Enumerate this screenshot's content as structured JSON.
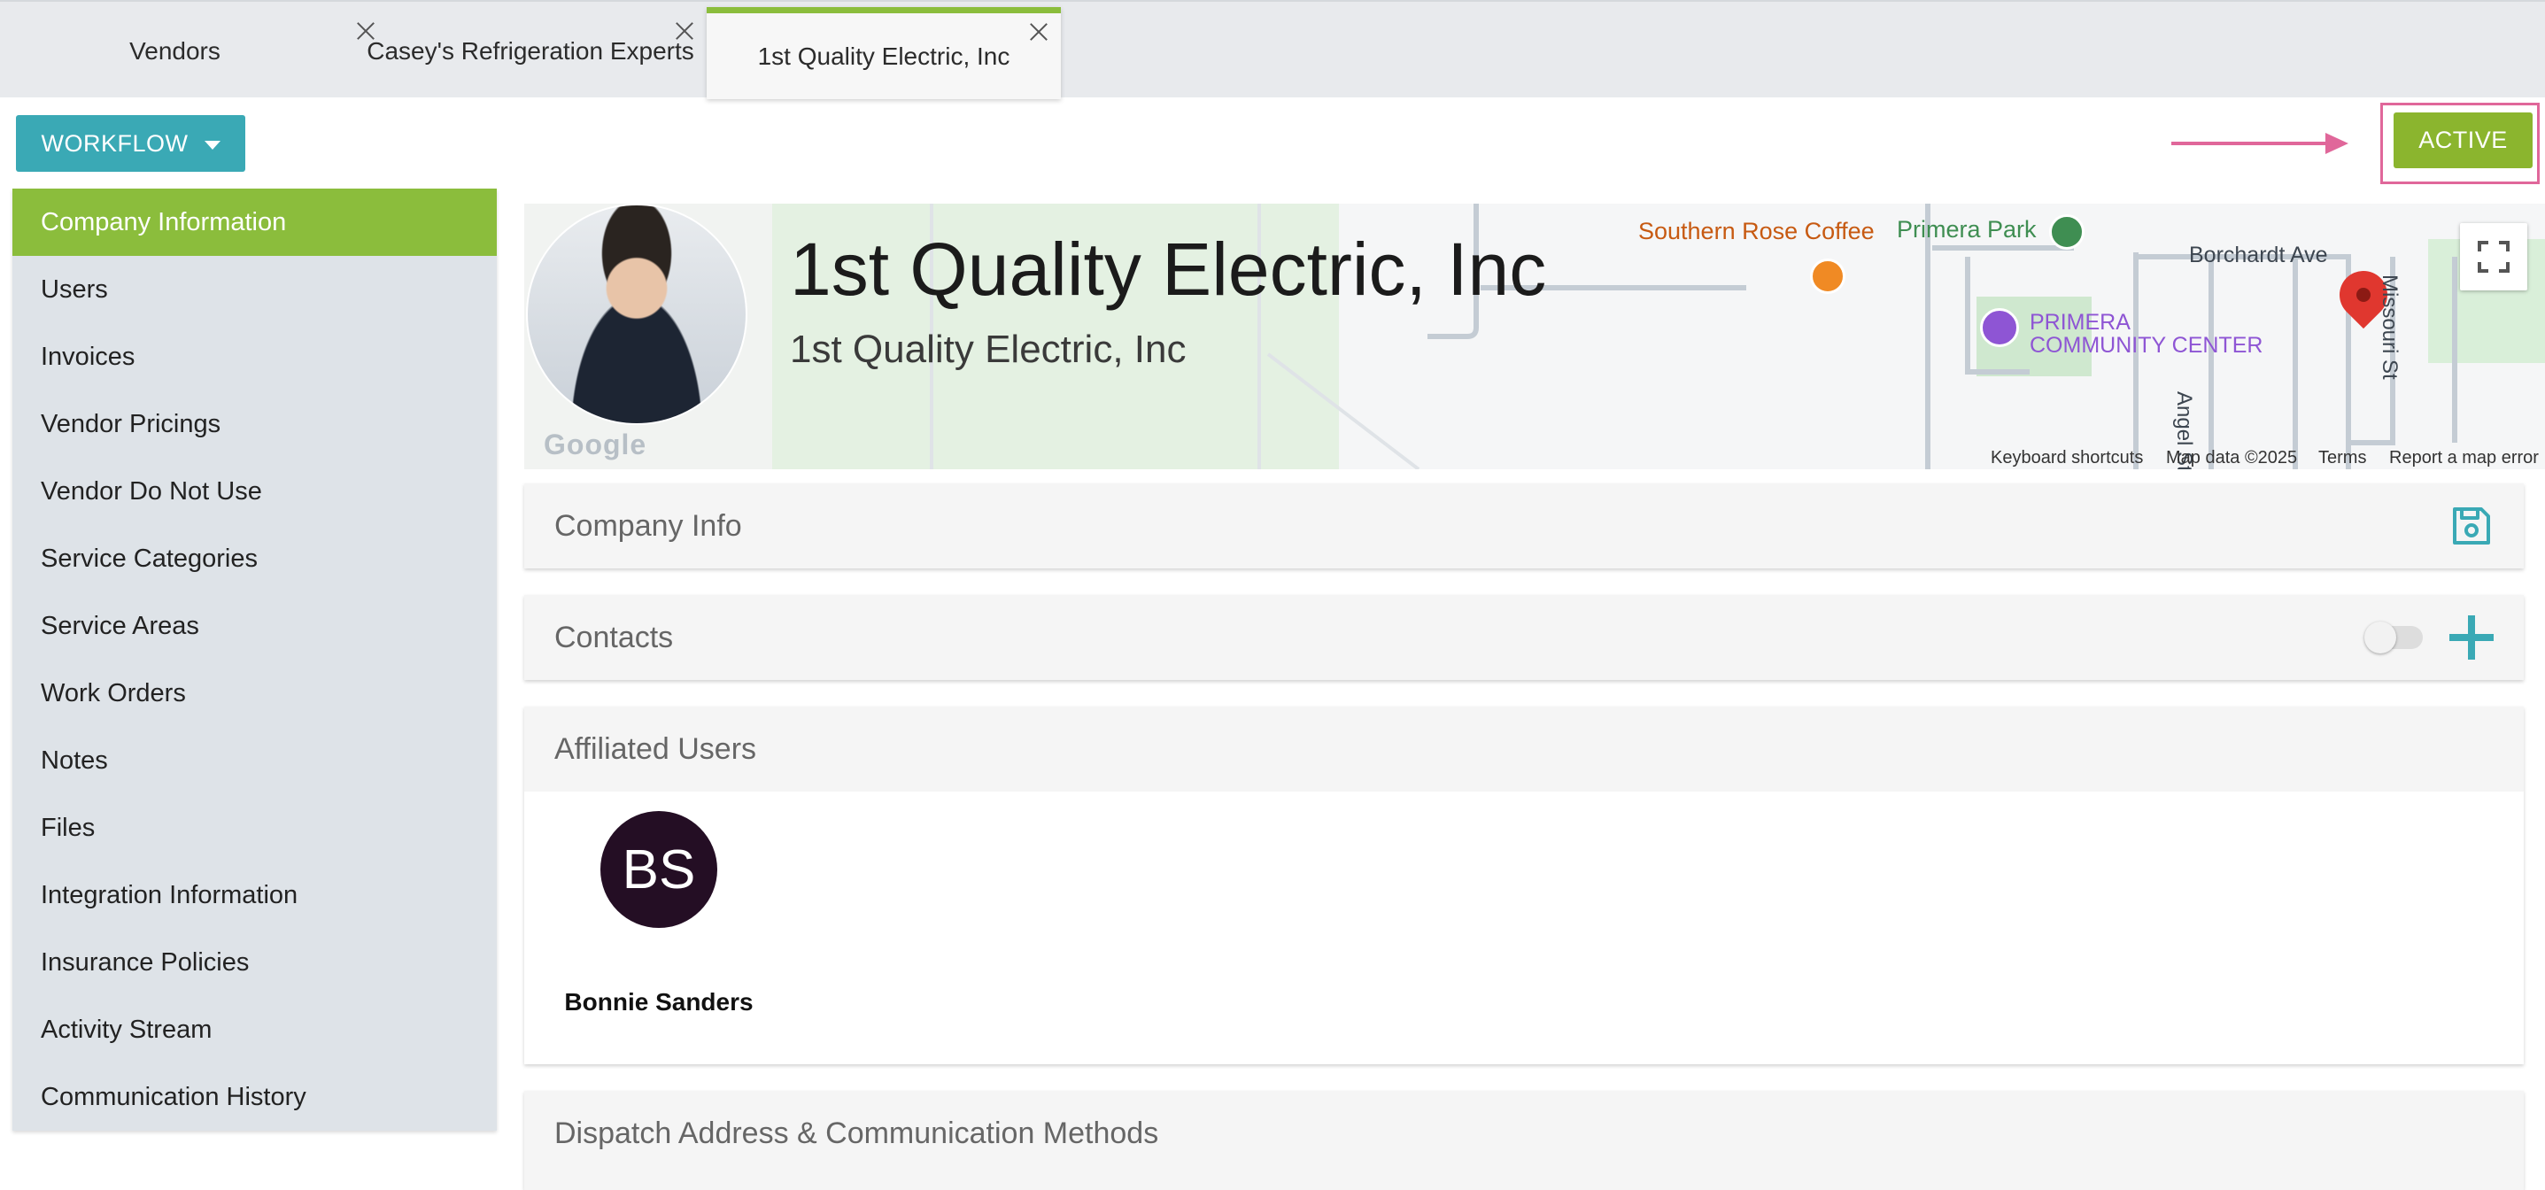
{
  "tabs": [
    {
      "label": "Vendors",
      "closable": false
    },
    {
      "label": "Casey's Refrigeration Experts",
      "closable": true
    },
    {
      "label": "1st Quality Electric, Inc",
      "closable": true,
      "active": true
    }
  ],
  "toolbar": {
    "workflow_label": "WORKFLOW",
    "status_label": "ACTIVE",
    "accent_color": "#3aa9b5",
    "status_color": "#8bb52e",
    "highlight_color": "#e0679a"
  },
  "sidebar": {
    "items": [
      {
        "label": "Company Information",
        "selected": true
      },
      {
        "label": "Users"
      },
      {
        "label": "Invoices"
      },
      {
        "label": "Vendor Pricings"
      },
      {
        "label": "Vendor Do Not Use"
      },
      {
        "label": "Service Categories"
      },
      {
        "label": "Service Areas"
      },
      {
        "label": "Work Orders"
      },
      {
        "label": "Notes"
      },
      {
        "label": "Files"
      },
      {
        "label": "Integration Information"
      },
      {
        "label": "Insurance Policies"
      },
      {
        "label": "Activity Stream"
      },
      {
        "label": "Communication History"
      }
    ]
  },
  "hero": {
    "title": "1st Quality Electric, Inc",
    "subtitle": "1st Quality Electric, Inc"
  },
  "map": {
    "labels": {
      "coffee": "Southern Rose Coffee",
      "park": "Primera Park",
      "borchardt": "Borchardt Ave",
      "center_line1": "PRIMERA",
      "center_line2": "COMMUNITY CENTER",
      "angel": "Angel St",
      "missouri": "Missouri St"
    },
    "google": "Google",
    "attribution": {
      "shortcuts": "Keyboard shortcuts",
      "data": "Map data ©2025",
      "terms": "Terms",
      "report": "Report a map error"
    }
  },
  "panels": {
    "company_info": "Company Info",
    "contacts": "Contacts",
    "affiliated_users": "Affiliated Users",
    "dispatch": "Dispatch Address & Communication Methods"
  },
  "affiliated_users": [
    {
      "initials": "BS",
      "name": "Bonnie Sanders"
    }
  ]
}
